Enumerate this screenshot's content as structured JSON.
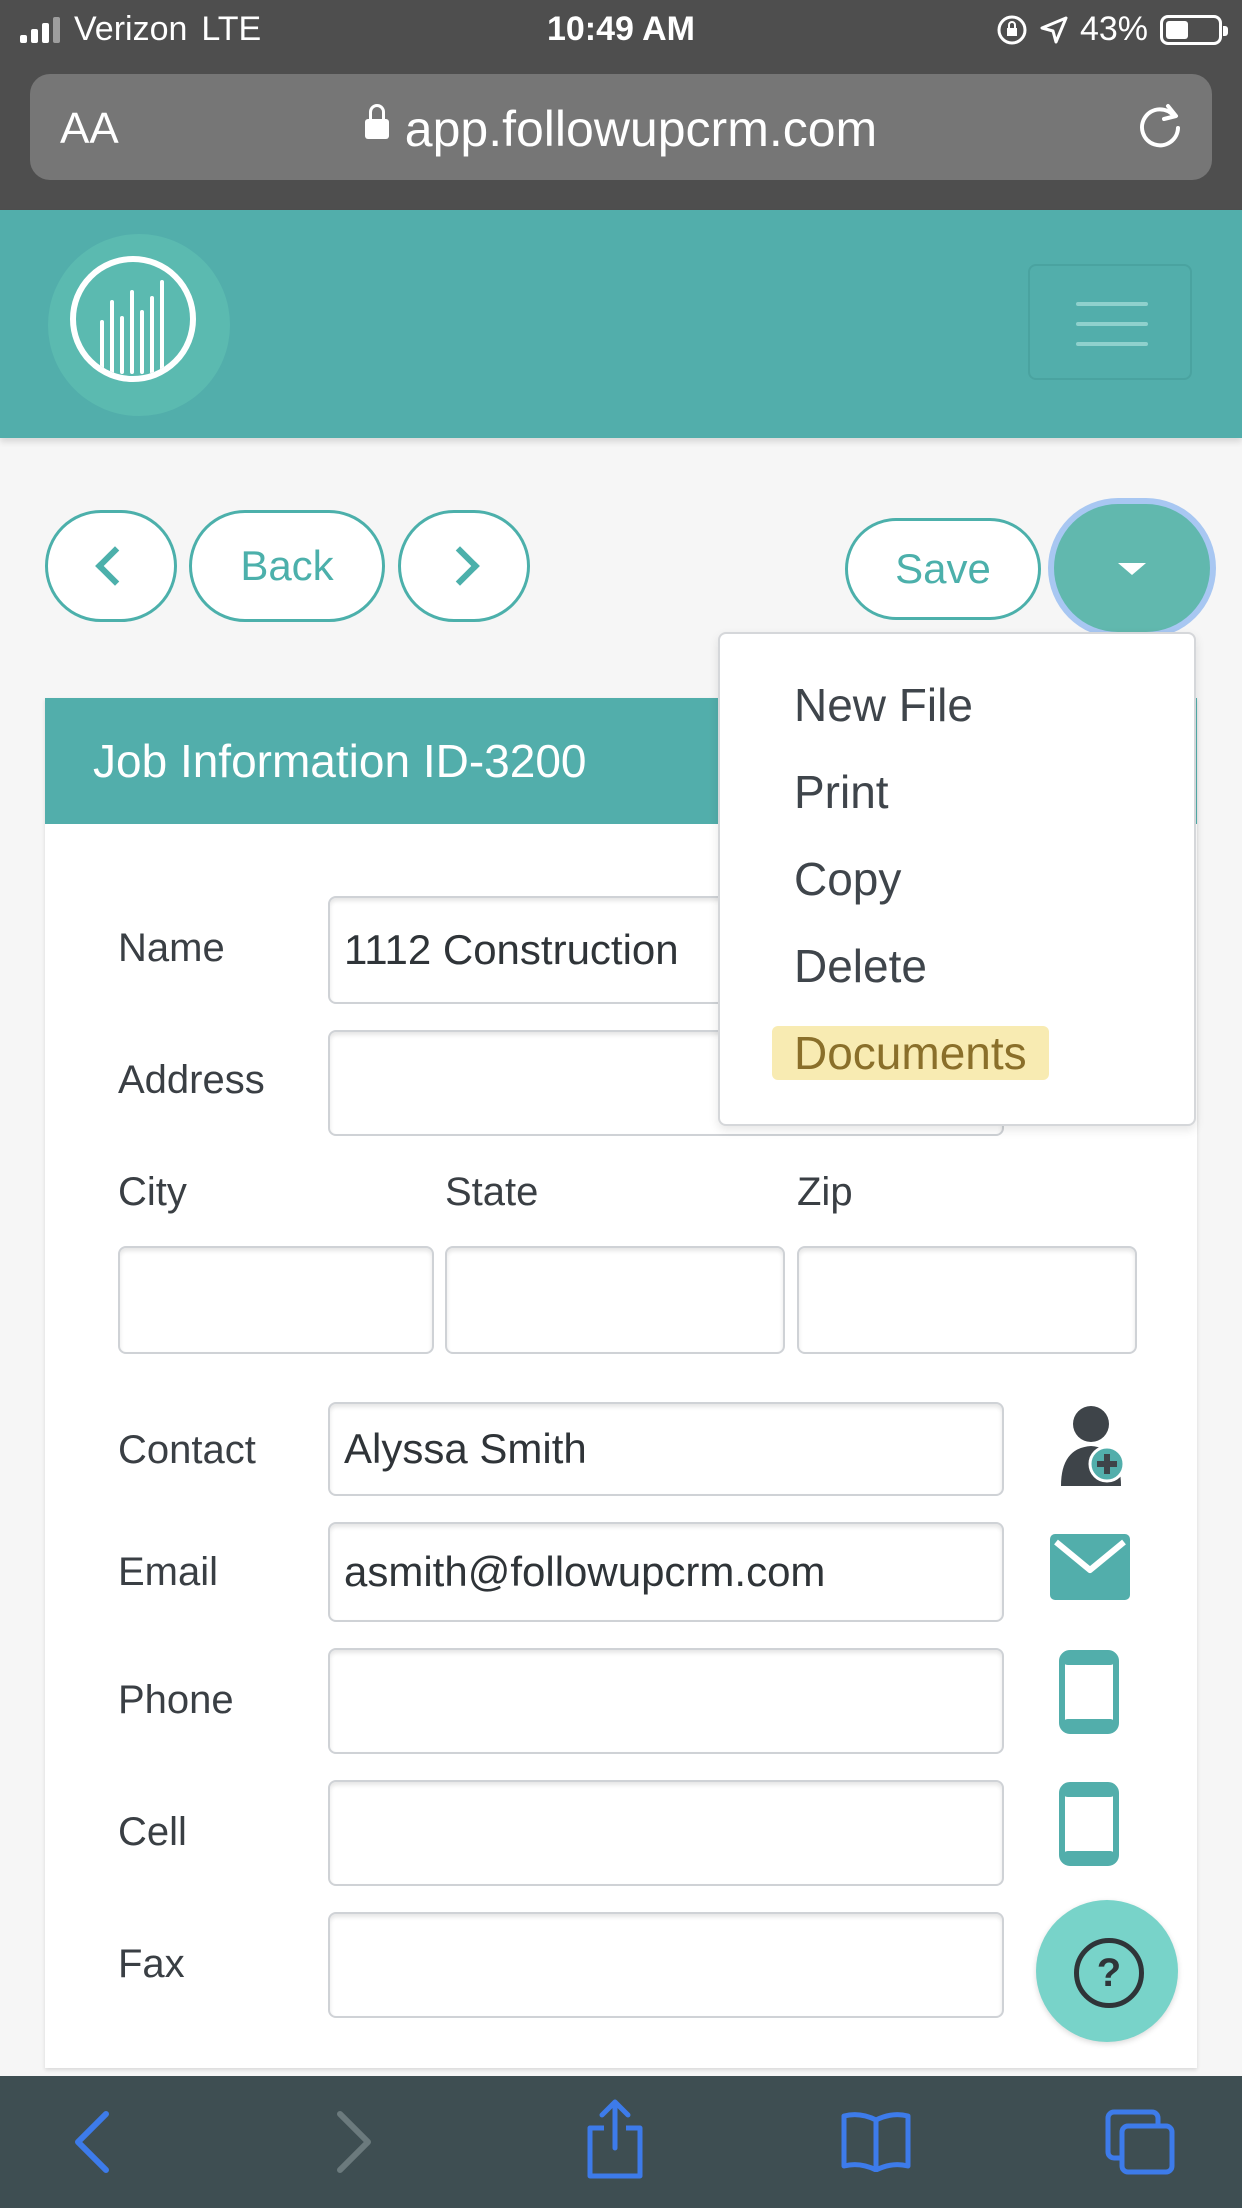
{
  "status_bar": {
    "carrier": "Verizon",
    "network": "LTE",
    "time": "10:49 AM",
    "battery": "43%",
    "battery_level": 0.43
  },
  "browser": {
    "text_size_label": "AA",
    "url": "app.followupcrm.com"
  },
  "toolbar": {
    "back_label": "Back",
    "save_label": "Save"
  },
  "dropdown_menu": {
    "items": [
      "New File",
      "Print",
      "Copy",
      "Delete",
      "Documents"
    ],
    "highlighted": "Documents"
  },
  "card": {
    "title": "Job Information ID-3200",
    "fields": {
      "name": {
        "label": "Name",
        "value": "1112 Construction"
      },
      "address": {
        "label": "Address",
        "value": ""
      },
      "city": {
        "label": "City",
        "value": ""
      },
      "state": {
        "label": "State",
        "value": ""
      },
      "zip": {
        "label": "Zip",
        "value": ""
      },
      "contact": {
        "label": "Contact",
        "value": "Alyssa Smith"
      },
      "email": {
        "label": "Email",
        "value": "asmith@followupcrm.com"
      },
      "phone": {
        "label": "Phone",
        "value": ""
      },
      "cell": {
        "label": "Cell",
        "value": ""
      },
      "fax": {
        "label": "Fax",
        "value": ""
      }
    }
  },
  "help_button": {
    "label": "?"
  },
  "colors": {
    "teal": "#52aeab",
    "accent": "#4cb0ab",
    "help": "#78d3c9",
    "highlight": "#f8ebb2",
    "safari_blue": "#3d7bea"
  },
  "icons": [
    "signal-icon",
    "lock-icon",
    "reload-icon",
    "logo-icon",
    "hamburger-icon",
    "chevron-left-icon",
    "chevron-right-icon",
    "caret-down-icon",
    "add-contact-icon",
    "envelope-icon",
    "phone-icon",
    "mobile-icon",
    "help-icon",
    "share-icon",
    "bookmarks-icon",
    "tabs-icon"
  ]
}
